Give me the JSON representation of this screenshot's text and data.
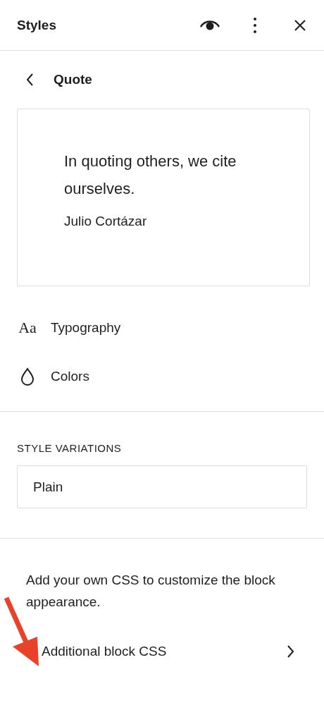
{
  "panel": {
    "title": "Styles"
  },
  "subheader": {
    "title": "Quote"
  },
  "preview": {
    "quote": "In quoting others, we cite ourselves.",
    "citation": "Julio Cortázar"
  },
  "tools": [
    {
      "kind": "typography",
      "label": "Typography",
      "icon_text": "Aa"
    },
    {
      "kind": "colors",
      "label": "Colors"
    }
  ],
  "style_variations": {
    "heading": "STYLE VARIATIONS",
    "options": [
      {
        "label": "Plain",
        "selected": false
      }
    ]
  },
  "custom_css": {
    "description": "Add your own CSS to customize the block appearance.",
    "link": "Additional block CSS"
  }
}
